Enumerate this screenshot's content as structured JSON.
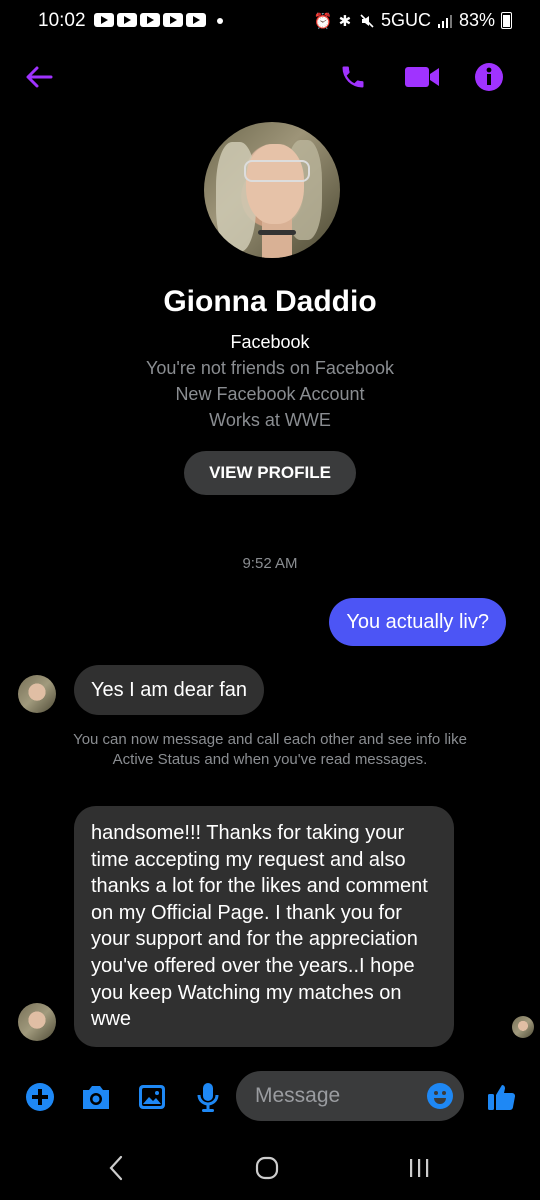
{
  "status_bar": {
    "time": "10:02",
    "network": "5GUC",
    "battery": "83%"
  },
  "header": {
    "back_icon": "arrow-left-icon",
    "call_icon": "phone-icon",
    "video_icon": "video-camera-icon",
    "info_icon": "info-icon",
    "accent_color": "#a033ff"
  },
  "profile": {
    "name": "Gionna Daddio",
    "platform": "Facebook",
    "friend_status": "You're not friends on Facebook",
    "account_note": "New Facebook Account",
    "work": "Works at WWE",
    "view_profile_label": "VIEW PROFILE"
  },
  "conversation": {
    "timestamp": "9:52 AM",
    "messages": [
      {
        "direction": "outgoing",
        "text": "You actually liv?"
      },
      {
        "direction": "incoming",
        "text": "Yes I am dear fan"
      },
      {
        "direction": "system",
        "text": "You can now message and call each other and see info like Active Status and when you've read messages."
      },
      {
        "direction": "incoming",
        "text": "handsome!!! Thanks for taking your time accepting my request and also thanks a lot for the likes and comment on my Official Page. I thank you for your support and for the appreciation you've offered over the years..I hope you keep Watching my matches on wwe"
      }
    ],
    "outgoing_color": "#4c55f5",
    "incoming_color": "#303030"
  },
  "composer": {
    "placeholder": "Message",
    "icons": [
      "plus-icon",
      "camera-icon",
      "gallery-icon",
      "microphone-icon",
      "emoji-icon",
      "thumbs-up-icon"
    ],
    "accent_color": "#1e88f5"
  },
  "system_nav": {
    "icons": [
      "back-icon",
      "home-icon",
      "recents-icon"
    ]
  }
}
